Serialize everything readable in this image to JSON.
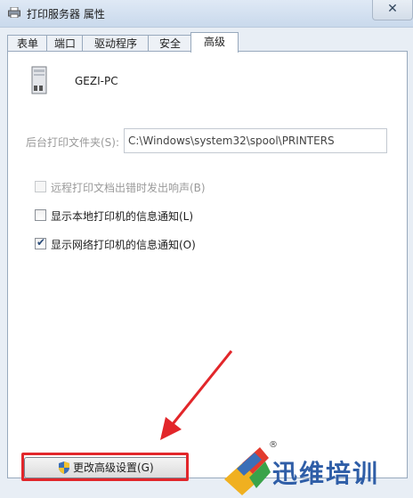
{
  "window": {
    "title": "打印服务器 属性",
    "close_symbol": "✕"
  },
  "tabs": [
    {
      "label": "表单",
      "active": false
    },
    {
      "label": "端口",
      "active": false
    },
    {
      "label": "驱动程序",
      "active": false
    },
    {
      "label": "安全",
      "active": false
    },
    {
      "label": "高级",
      "active": true
    }
  ],
  "computer": {
    "name": "GEZI-PC",
    "icon": "computer-tower-icon"
  },
  "spool_folder": {
    "label": "后台打印文件夹(S):",
    "value": "C:\\Windows\\system32\\spool\\PRINTERS",
    "disabled": true
  },
  "options": [
    {
      "label": "远程打印文档出错时发出响声(B)",
      "checked": false,
      "disabled": true
    },
    {
      "label": "显示本地打印机的信息通知(L)",
      "checked": false,
      "disabled": false
    },
    {
      "label": "显示网络打印机的信息通知(O)",
      "checked": true,
      "disabled": false
    }
  ],
  "change_button": {
    "label": "更改高级设置(G)",
    "icon": "uac-shield-icon"
  },
  "watermark": {
    "text": "迅维培训",
    "reg_mark": "®"
  },
  "colors": {
    "annotation_red": "#e2262a",
    "watermark_blue": "#2f5ea7"
  }
}
